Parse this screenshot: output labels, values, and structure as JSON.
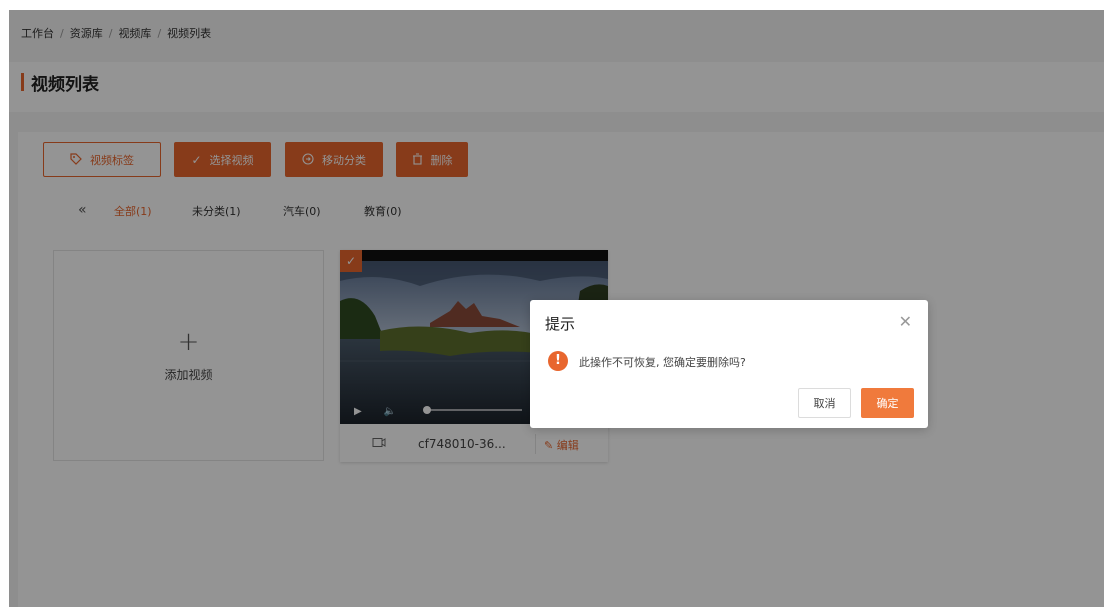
{
  "breadcrumb": [
    "工作台",
    "资源库",
    "视频库",
    "视频列表"
  ],
  "page_title": "视频列表",
  "toolbar": {
    "tag_label": "视频标签",
    "select_label": "选择视频",
    "move_label": "移动分类",
    "delete_label": "删除"
  },
  "tabs": {
    "collapse_icon": "«",
    "items": [
      {
        "label": "全部(1)",
        "active": true
      },
      {
        "label": "未分类(1)",
        "active": false
      },
      {
        "label": "汽车(0)",
        "active": false
      },
      {
        "label": "教育(0)",
        "active": false
      }
    ]
  },
  "add_video": {
    "plus": "+",
    "label": "添加视频"
  },
  "video_card": {
    "file_name": "cf748010-36...",
    "edit_label": "编辑",
    "selected": true,
    "play_progress": 0
  },
  "dialog": {
    "title": "提示",
    "message": "此操作不可恢复, 您确定要删除吗?",
    "cancel_label": "取消",
    "confirm_label": "确定",
    "warn_glyph": "!"
  },
  "colors": {
    "accent": "#e8662e",
    "confirm": "#f07a3c",
    "overlay": "rgba(0,0,0,0.42)"
  },
  "icons": {
    "tag": "tag-icon",
    "check": "check-icon",
    "move": "move-icon",
    "trash": "trash-icon",
    "play": "play-icon",
    "volume": "volume-icon",
    "camera": "camera-icon",
    "pencil": "pencil-icon",
    "close": "close-icon",
    "warning": "warning-icon"
  }
}
